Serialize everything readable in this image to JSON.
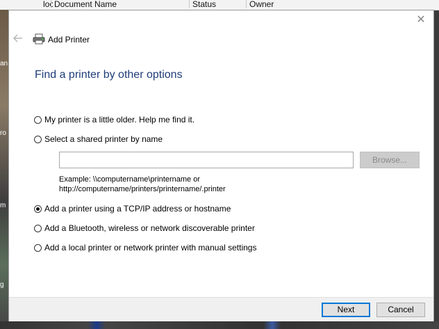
{
  "background": {
    "col_short": "loc",
    "columns": [
      "Document Name",
      "Status",
      "Owner"
    ],
    "left_labels": [
      "an",
      "ro",
      "m",
      "g"
    ]
  },
  "dialog": {
    "title": "Add Printer",
    "heading": "Find a printer by other options",
    "options": [
      {
        "label": "My printer is a little older. Help me find it.",
        "checked": false
      },
      {
        "label": "Select a shared printer by name",
        "checked": false
      },
      {
        "label": "Add a printer using a TCP/IP address or hostname",
        "checked": true
      },
      {
        "label": "Add a Bluetooth, wireless or network discoverable printer",
        "checked": false
      },
      {
        "label": "Add a local printer or network printer with manual settings",
        "checked": false
      }
    ],
    "shared_printer": {
      "value": "",
      "browse_label": "Browse...",
      "example_line1": "Example: \\\\computername\\printername or",
      "example_line2": "http://computername/printers/printername/.printer"
    },
    "buttons": {
      "next": "Next",
      "cancel": "Cancel"
    }
  },
  "icons": {
    "close": "close-icon",
    "back": "back-arrow-icon",
    "printer": "printer-icon"
  },
  "colors": {
    "heading": "#1e3c78",
    "accent": "#0078d7"
  }
}
